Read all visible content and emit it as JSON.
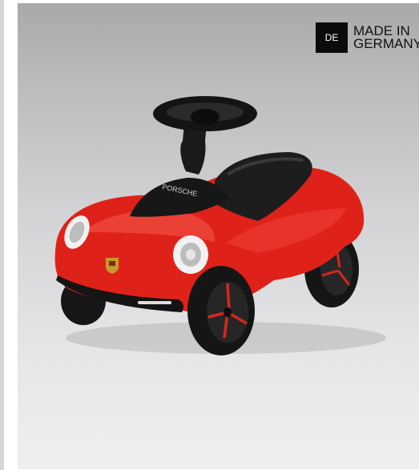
{
  "badge": {
    "country_code": "DE",
    "line1": "MADE IN",
    "line2": "GERMANY"
  },
  "product": {
    "brand_text": "PORSCHE",
    "icon": "ride-on-toy-car",
    "color": "#e2231a"
  }
}
